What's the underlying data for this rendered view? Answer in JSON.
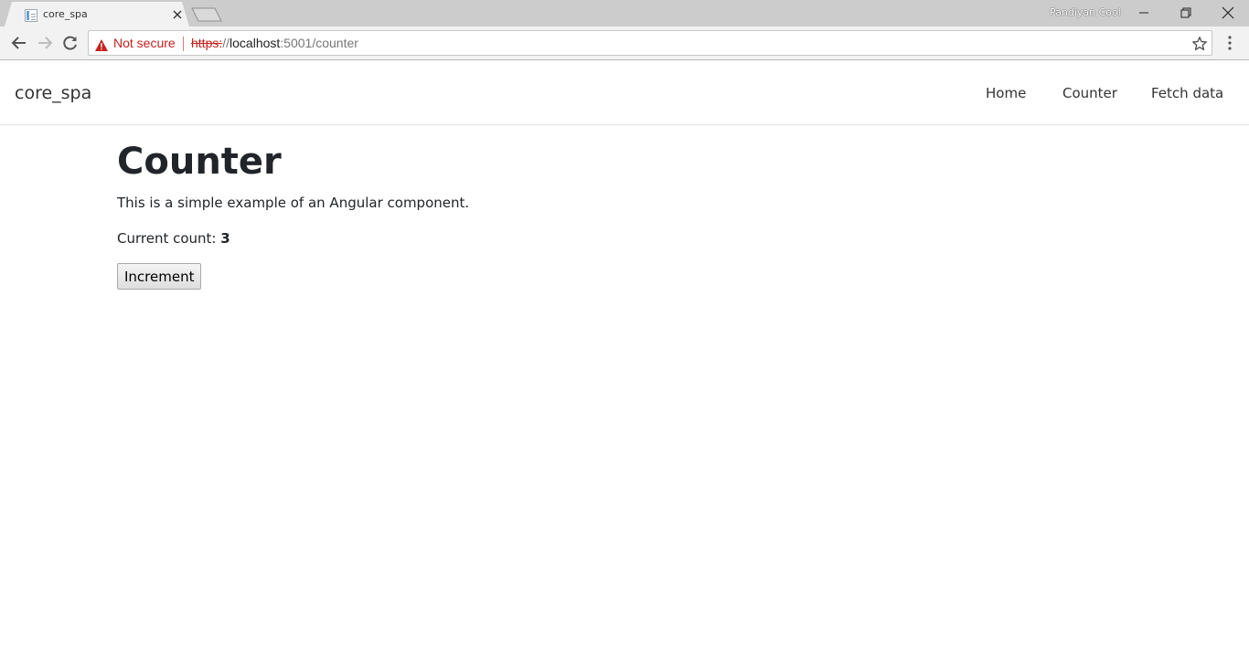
{
  "browser": {
    "tab_title": "core_spa",
    "profile_name": "Pandiyan Cool",
    "security_label": "Not secure",
    "url_scheme": "https:",
    "url_slashes": "//",
    "url_host": "localhost",
    "url_rest": ":5001/counter"
  },
  "navbar": {
    "brand": "core_spa",
    "links": [
      {
        "label": "Home"
      },
      {
        "label": "Counter"
      },
      {
        "label": "Fetch data"
      }
    ]
  },
  "main": {
    "title": "Counter",
    "description": "This is a simple example of an Angular component.",
    "count_label": "Current count: ",
    "count_value": "3",
    "increment_label": "Increment"
  },
  "colors": {
    "warning_red": "#c5221f",
    "chrome_gray": "#cccccc"
  }
}
